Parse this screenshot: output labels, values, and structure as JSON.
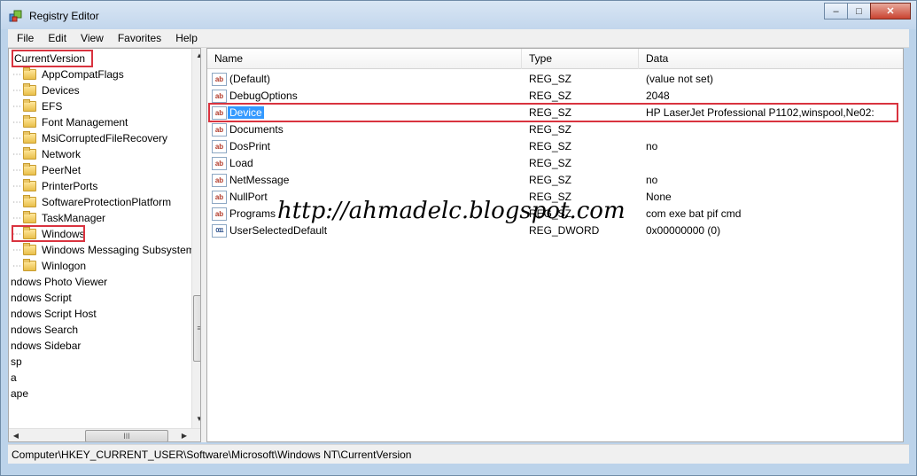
{
  "window": {
    "title": "Registry Editor",
    "minimize": "–",
    "restore": "□",
    "close": "✕"
  },
  "menu": [
    "File",
    "Edit",
    "View",
    "Favorites",
    "Help"
  ],
  "tree": {
    "items": [
      {
        "label": "CurrentVersion",
        "folder": false
      },
      {
        "label": "AppCompatFlags",
        "folder": true
      },
      {
        "label": "Devices",
        "folder": true
      },
      {
        "label": "EFS",
        "folder": true
      },
      {
        "label": "Font Management",
        "folder": true
      },
      {
        "label": "MsiCorruptedFileRecovery",
        "folder": true
      },
      {
        "label": "Network",
        "folder": true
      },
      {
        "label": "PeerNet",
        "folder": true
      },
      {
        "label": "PrinterPorts",
        "folder": true
      },
      {
        "label": "SoftwareProtectionPlatform",
        "folder": true
      },
      {
        "label": "TaskManager",
        "folder": true
      },
      {
        "label": "Windows",
        "folder": true
      },
      {
        "label": "Windows Messaging Subsystem",
        "folder": true
      },
      {
        "label": "Winlogon",
        "folder": true
      },
      {
        "label": "ndows Photo Viewer",
        "folder": false
      },
      {
        "label": "ndows Script",
        "folder": false
      },
      {
        "label": "ndows Script Host",
        "folder": false
      },
      {
        "label": "ndows Search",
        "folder": false
      },
      {
        "label": "ndows Sidebar",
        "folder": false
      },
      {
        "label": "sp",
        "folder": false
      },
      {
        "label": "a",
        "folder": false
      },
      {
        "label": "ape",
        "folder": false
      }
    ]
  },
  "list": {
    "columns": {
      "name": "Name",
      "type": "Type",
      "data": "Data"
    },
    "rows": [
      {
        "icon": "ab",
        "name": "(Default)",
        "type": "REG_SZ",
        "data": "(value not set)"
      },
      {
        "icon": "ab",
        "name": "DebugOptions",
        "type": "REG_SZ",
        "data": "2048"
      },
      {
        "icon": "ab",
        "name": "Device",
        "type": "REG_SZ",
        "data": "HP LaserJet Professional P1102,winspool,Ne02:"
      },
      {
        "icon": "ab",
        "name": "Documents",
        "type": "REG_SZ",
        "data": ""
      },
      {
        "icon": "ab",
        "name": "DosPrint",
        "type": "REG_SZ",
        "data": "no"
      },
      {
        "icon": "ab",
        "name": "Load",
        "type": "REG_SZ",
        "data": ""
      },
      {
        "icon": "ab",
        "name": "NetMessage",
        "type": "REG_SZ",
        "data": "no"
      },
      {
        "icon": "ab",
        "name": "NullPort",
        "type": "REG_SZ",
        "data": "None"
      },
      {
        "icon": "ab",
        "name": "Programs",
        "type": "REG_SZ",
        "data": "com exe bat pif cmd"
      },
      {
        "icon": "011",
        "name": "UserSelectedDefault",
        "type": "REG_DWORD",
        "data": "0x00000000 (0)"
      }
    ]
  },
  "watermark": "http://ahmadelc.blogspot.com",
  "statusbar": "Computer\\HKEY_CURRENT_USER\\Software\\Microsoft\\Windows NT\\CurrentVersion",
  "colors": {
    "highlight": "#d9333f",
    "selection": "#3399ff"
  }
}
